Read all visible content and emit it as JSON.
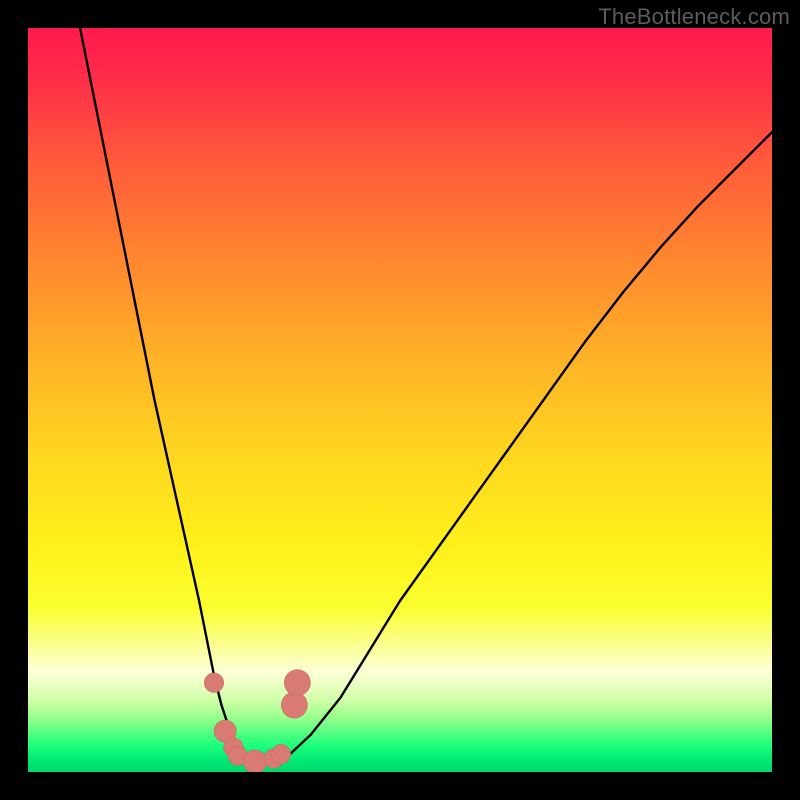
{
  "watermark": "TheBottleneck.com",
  "colors": {
    "black": "#000000",
    "curve": "#000000",
    "marker_fill": "#d97a73",
    "marker_stroke": "#c86a63",
    "gradient_stops": [
      {
        "offset": 0.0,
        "color": "#ff1a4e"
      },
      {
        "offset": 0.06,
        "color": "#ff2a4a"
      },
      {
        "offset": 0.18,
        "color": "#ff5a3a"
      },
      {
        "offset": 0.32,
        "color": "#ff8a2e"
      },
      {
        "offset": 0.46,
        "color": "#ffb726"
      },
      {
        "offset": 0.58,
        "color": "#ffd81f"
      },
      {
        "offset": 0.7,
        "color": "#fff11a"
      },
      {
        "offset": 0.78,
        "color": "#fbff30"
      },
      {
        "offset": 0.84,
        "color": "#fbffa6"
      },
      {
        "offset": 0.865,
        "color": "#fcffd6"
      },
      {
        "offset": 0.885,
        "color": "#e8ffc0"
      },
      {
        "offset": 0.905,
        "color": "#ccffa6"
      },
      {
        "offset": 0.925,
        "color": "#9dff8e"
      },
      {
        "offset": 0.945,
        "color": "#5cff82"
      },
      {
        "offset": 0.965,
        "color": "#1aff7a"
      },
      {
        "offset": 0.985,
        "color": "#00e874"
      },
      {
        "offset": 1.0,
        "color": "#00d870"
      }
    ]
  },
  "chart_data": {
    "type": "line",
    "title": "",
    "xlabel": "",
    "ylabel": "",
    "xlim": [
      0,
      100
    ],
    "ylim": [
      0,
      100
    ],
    "grid": false,
    "series": [
      {
        "name": "bottleneck-curve",
        "x": [
          7,
          9,
          11,
          13,
          15,
          17,
          19,
          21,
          23,
          24,
          25,
          26,
          27,
          28,
          29,
          30,
          31,
          33,
          35,
          38,
          42,
          46,
          50,
          55,
          60,
          65,
          70,
          75,
          80,
          85,
          90,
          95,
          100
        ],
        "y": [
          100,
          90,
          80,
          70,
          60,
          50,
          41,
          32,
          23,
          18,
          13,
          9,
          6,
          3.5,
          2,
          1.2,
          1,
          1.3,
          2.2,
          5,
          10,
          16.5,
          23,
          30,
          37,
          44,
          51,
          58,
          64.5,
          70.5,
          76,
          81,
          86
        ]
      }
    ],
    "markers": [
      {
        "x": 25.0,
        "y": 12.0,
        "r": 1.0
      },
      {
        "x": 26.5,
        "y": 5.5,
        "r": 1.2
      },
      {
        "x": 27.6,
        "y": 3.3,
        "r": 1.0
      },
      {
        "x": 28.2,
        "y": 2.2,
        "r": 1.0
      },
      {
        "x": 30.5,
        "y": 1.4,
        "r": 1.3
      },
      {
        "x": 33.0,
        "y": 1.8,
        "r": 1.0
      },
      {
        "x": 34.0,
        "y": 2.4,
        "r": 1.0
      },
      {
        "x": 35.8,
        "y": 9.0,
        "r": 1.5
      },
      {
        "x": 36.2,
        "y": 12.0,
        "r": 1.5
      }
    ]
  }
}
